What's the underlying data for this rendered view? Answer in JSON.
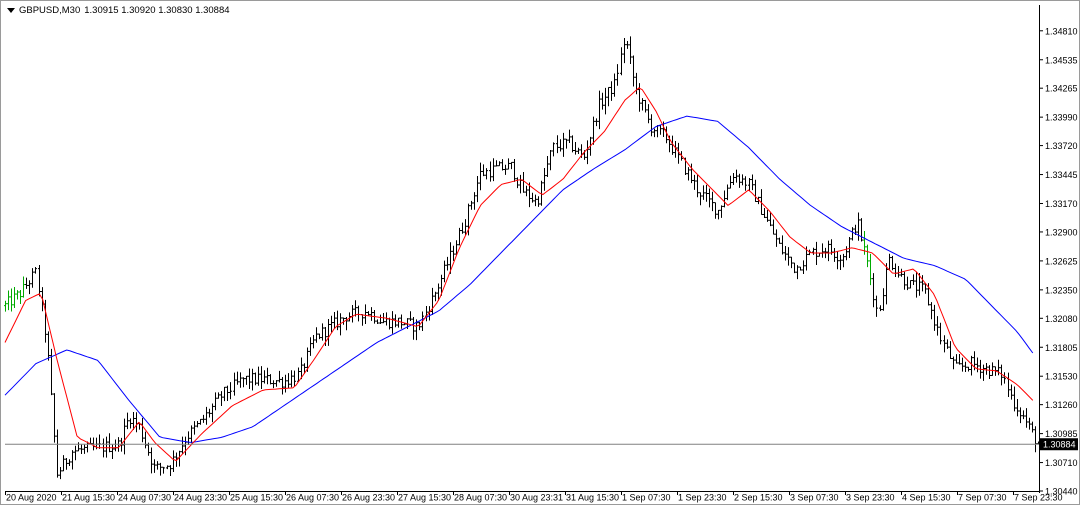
{
  "header": {
    "symbol_timeframe": "GBPUSD,M30",
    "ohlc": "1.30915 1.30920 1.30830 1.30884"
  },
  "colors": {
    "background": "#ffffff",
    "bars": "#000000",
    "bull_highlight": "#00aa00",
    "ma_fast": "#ff0000",
    "ma_slow": "#0000ff",
    "bid_line": "#808080",
    "price_tag_bg": "#000000",
    "price_tag_text": "#ffffff"
  },
  "chart_data": {
    "type": "ohlc",
    "title": "GBPUSD,M30",
    "xlabel": "",
    "ylabel": "",
    "ylim": [
      1.3044,
      1.3496
    ],
    "grid": false,
    "legend": "none",
    "y_ticks": [
      "1.34810",
      "1.34535",
      "1.34265",
      "1.33990",
      "1.33720",
      "1.33445",
      "1.33170",
      "1.32900",
      "1.32625",
      "1.32350",
      "1.32080",
      "1.31805",
      "1.31530",
      "1.31260",
      "1.30985",
      "1.30710",
      "1.30440"
    ],
    "current_price": "1.30884",
    "x_ticks": [
      "20 Aug 2020",
      "21 Aug 15:30",
      "24 Aug 07:30",
      "24 Aug 23:30",
      "25 Aug 15:30",
      "26 Aug 07:30",
      "26 Aug 23:30",
      "27 Aug 15:30",
      "28 Aug 07:30",
      "30 Aug 23:31",
      "31 Aug 15:30",
      "1 Sep 07:30",
      "1 Sep 23:30",
      "2 Sep 15:30",
      "3 Sep 07:30",
      "3 Sep 23:30",
      "4 Sep 15:30",
      "7 Sep 07:30",
      "7 Sep 23:30"
    ],
    "close_path": [
      [
        0,
        1.322
      ],
      [
        0.015,
        1.3232
      ],
      [
        0.03,
        1.3252
      ],
      [
        0.04,
        1.3185
      ],
      [
        0.05,
        1.306
      ],
      [
        0.065,
        1.3082
      ],
      [
        0.09,
        1.3085
      ],
      [
        0.11,
        1.3088
      ],
      [
        0.12,
        1.3115
      ],
      [
        0.13,
        1.3105
      ],
      [
        0.145,
        1.3065
      ],
      [
        0.16,
        1.307
      ],
      [
        0.175,
        1.3095
      ],
      [
        0.19,
        1.311
      ],
      [
        0.21,
        1.3135
      ],
      [
        0.23,
        1.315
      ],
      [
        0.25,
        1.315
      ],
      [
        0.27,
        1.3148
      ],
      [
        0.285,
        1.3155
      ],
      [
        0.3,
        1.319
      ],
      [
        0.315,
        1.32
      ],
      [
        0.33,
        1.321
      ],
      [
        0.35,
        1.3215
      ],
      [
        0.365,
        1.3205
      ],
      [
        0.38,
        1.3205
      ],
      [
        0.4,
        1.32
      ],
      [
        0.415,
        1.323
      ],
      [
        0.43,
        1.3265
      ],
      [
        0.445,
        1.33
      ],
      [
        0.46,
        1.3345
      ],
      [
        0.475,
        1.335
      ],
      [
        0.49,
        1.3352
      ],
      [
        0.5,
        1.333
      ],
      [
        0.515,
        1.3318
      ],
      [
        0.53,
        1.337
      ],
      [
        0.545,
        1.3375
      ],
      [
        0.56,
        1.336
      ],
      [
        0.575,
        1.341
      ],
      [
        0.59,
        1.343
      ],
      [
        0.6,
        1.3475
      ],
      [
        0.61,
        1.3425
      ],
      [
        0.625,
        1.339
      ],
      [
        0.64,
        1.338
      ],
      [
        0.655,
        1.3355
      ],
      [
        0.67,
        1.333
      ],
      [
        0.69,
        1.331
      ],
      [
        0.705,
        1.3345
      ],
      [
        0.72,
        1.3335
      ],
      [
        0.735,
        1.3305
      ],
      [
        0.75,
        1.3275
      ],
      [
        0.765,
        1.3255
      ],
      [
        0.78,
        1.327
      ],
      [
        0.795,
        1.3275
      ],
      [
        0.81,
        1.3265
      ],
      [
        0.825,
        1.33
      ],
      [
        0.835,
        1.326
      ],
      [
        0.845,
        1.321
      ],
      [
        0.855,
        1.3265
      ],
      [
        0.865,
        1.325
      ],
      [
        0.875,
        1.324
      ],
      [
        0.89,
        1.3235
      ],
      [
        0.905,
        1.319
      ],
      [
        0.92,
        1.316
      ],
      [
        0.935,
        1.3165
      ],
      [
        0.95,
        1.316
      ],
      [
        0.965,
        1.3155
      ],
      [
        0.975,
        1.313
      ],
      [
        0.985,
        1.3115
      ],
      [
        1.0,
        1.30884
      ]
    ],
    "ma_fast_path": [
      [
        0,
        1.3185
      ],
      [
        0.02,
        1.3225
      ],
      [
        0.035,
        1.3232
      ],
      [
        0.05,
        1.317
      ],
      [
        0.07,
        1.3095
      ],
      [
        0.09,
        1.3085
      ],
      [
        0.11,
        1.3085
      ],
      [
        0.13,
        1.311
      ],
      [
        0.145,
        1.309
      ],
      [
        0.165,
        1.3072
      ],
      [
        0.19,
        1.3098
      ],
      [
        0.22,
        1.3125
      ],
      [
        0.25,
        1.314
      ],
      [
        0.28,
        1.3142
      ],
      [
        0.3,
        1.317
      ],
      [
        0.32,
        1.32
      ],
      [
        0.34,
        1.3212
      ],
      [
        0.37,
        1.3208
      ],
      [
        0.4,
        1.32
      ],
      [
        0.42,
        1.3225
      ],
      [
        0.44,
        1.3275
      ],
      [
        0.46,
        1.3315
      ],
      [
        0.48,
        1.3335
      ],
      [
        0.5,
        1.334
      ],
      [
        0.52,
        1.3325
      ],
      [
        0.54,
        1.334
      ],
      [
        0.56,
        1.3365
      ],
      [
        0.58,
        1.3385
      ],
      [
        0.6,
        1.3415
      ],
      [
        0.615,
        1.3428
      ],
      [
        0.63,
        1.3405
      ],
      [
        0.645,
        1.3375
      ],
      [
        0.665,
        1.335
      ],
      [
        0.685,
        1.333
      ],
      [
        0.7,
        1.3315
      ],
      [
        0.72,
        1.333
      ],
      [
        0.74,
        1.331
      ],
      [
        0.76,
        1.3285
      ],
      [
        0.78,
        1.327
      ],
      [
        0.8,
        1.327
      ],
      [
        0.82,
        1.3275
      ],
      [
        0.84,
        1.327
      ],
      [
        0.86,
        1.325
      ],
      [
        0.88,
        1.3255
      ],
      [
        0.9,
        1.323
      ],
      [
        0.92,
        1.318
      ],
      [
        0.94,
        1.316
      ],
      [
        0.96,
        1.3158
      ],
      [
        0.98,
        1.3145
      ],
      [
        0.995,
        1.313
      ]
    ],
    "ma_slow_path": [
      [
        0,
        1.3135
      ],
      [
        0.03,
        1.3165
      ],
      [
        0.06,
        1.3178
      ],
      [
        0.09,
        1.3168
      ],
      [
        0.12,
        1.313
      ],
      [
        0.15,
        1.3095
      ],
      [
        0.18,
        1.309
      ],
      [
        0.21,
        1.3095
      ],
      [
        0.24,
        1.3105
      ],
      [
        0.27,
        1.3125
      ],
      [
        0.3,
        1.3145
      ],
      [
        0.33,
        1.3165
      ],
      [
        0.36,
        1.3185
      ],
      [
        0.39,
        1.32
      ],
      [
        0.42,
        1.3215
      ],
      [
        0.45,
        1.324
      ],
      [
        0.48,
        1.327
      ],
      [
        0.51,
        1.33
      ],
      [
        0.54,
        1.333
      ],
      [
        0.57,
        1.335
      ],
      [
        0.6,
        1.3368
      ],
      [
        0.63,
        1.339
      ],
      [
        0.66,
        1.34
      ],
      [
        0.69,
        1.3395
      ],
      [
        0.72,
        1.337
      ],
      [
        0.75,
        1.334
      ],
      [
        0.78,
        1.3315
      ],
      [
        0.81,
        1.3295
      ],
      [
        0.84,
        1.328
      ],
      [
        0.87,
        1.3265
      ],
      [
        0.9,
        1.3258
      ],
      [
        0.93,
        1.3245
      ],
      [
        0.96,
        1.3215
      ],
      [
        0.98,
        1.3195
      ],
      [
        0.995,
        1.3175
      ]
    ]
  }
}
